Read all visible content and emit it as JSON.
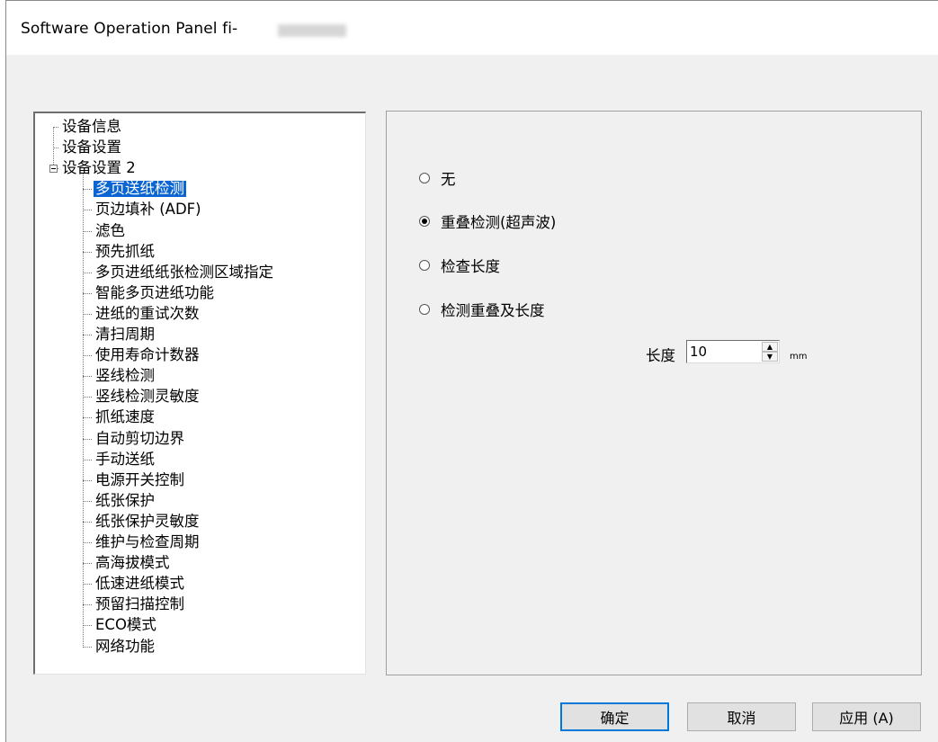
{
  "window": {
    "title": "Software Operation Panel fi-"
  },
  "tree": {
    "items": [
      {
        "label": "设备信息",
        "level": 1
      },
      {
        "label": "设备设置",
        "level": 1
      },
      {
        "label": "设备设置 2",
        "level": 1,
        "expanded": true
      },
      {
        "label": "多页送纸检测",
        "level": 2,
        "selected": true
      },
      {
        "label": "页边填补 (ADF)",
        "level": 2
      },
      {
        "label": "滤色",
        "level": 2
      },
      {
        "label": "预先抓纸",
        "level": 2
      },
      {
        "label": "多页进纸纸张检测区域指定",
        "level": 2
      },
      {
        "label": "智能多页进纸功能",
        "level": 2
      },
      {
        "label": "进纸的重试次数",
        "level": 2
      },
      {
        "label": "清扫周期",
        "level": 2
      },
      {
        "label": "使用寿命计数器",
        "level": 2
      },
      {
        "label": "竖线检测",
        "level": 2
      },
      {
        "label": "竖线检测灵敏度",
        "level": 2
      },
      {
        "label": "抓纸速度",
        "level": 2
      },
      {
        "label": "自动剪切边界",
        "level": 2
      },
      {
        "label": "手动送纸",
        "level": 2
      },
      {
        "label": "电源开关控制",
        "level": 2
      },
      {
        "label": "纸张保护",
        "level": 2
      },
      {
        "label": "纸张保护灵敏度",
        "level": 2
      },
      {
        "label": "维护与检查周期",
        "level": 2
      },
      {
        "label": "高海拔模式",
        "level": 2
      },
      {
        "label": "低速进纸模式",
        "level": 2
      },
      {
        "label": "预留扫描控制",
        "level": 2
      },
      {
        "label": "ECO模式",
        "level": 2
      },
      {
        "label": "网络功能",
        "level": 2
      }
    ]
  },
  "panel": {
    "options": [
      {
        "label": "无",
        "checked": false
      },
      {
        "label": "重叠检测(超声波)",
        "checked": true
      },
      {
        "label": "检查长度",
        "checked": false
      },
      {
        "label": "检测重叠及长度",
        "checked": false
      }
    ],
    "length": {
      "label": "长度",
      "value": "10",
      "unit": "mm"
    }
  },
  "buttons": {
    "ok": "确定",
    "cancel": "取消",
    "apply": "应用 (A)"
  }
}
